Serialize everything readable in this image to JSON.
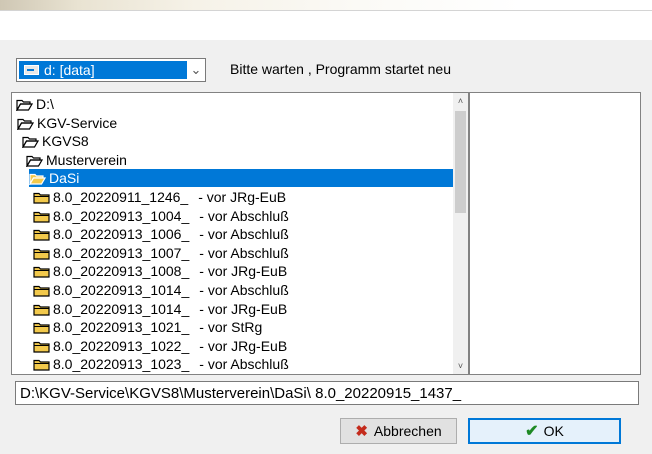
{
  "drive": {
    "label": "d: [data]",
    "arrow": "⌄"
  },
  "status": "Bitte warten , Programm startet neu",
  "tree": [
    {
      "name": "D:\\",
      "suffix": "",
      "icon": "open-folder",
      "depth": 0,
      "selected": false
    },
    {
      "name": "KGV-Service",
      "suffix": "",
      "icon": "open-folder",
      "depth": 1,
      "selected": false
    },
    {
      "name": "KGVS8",
      "suffix": "",
      "icon": "open-folder",
      "depth": 2,
      "selected": false
    },
    {
      "name": "Musterverein",
      "suffix": "",
      "icon": "open-folder",
      "depth": 3,
      "selected": false
    },
    {
      "name": "DaSi",
      "suffix": "",
      "icon": "open-folder",
      "depth": 4,
      "selected": true
    },
    {
      "name": "8.0_20220911_1246_",
      "suffix": "- vor JRg-EuB",
      "icon": "closed-folder",
      "depth": 5,
      "selected": false
    },
    {
      "name": "8.0_20220913_1004_",
      "suffix": "- vor Abschluß",
      "icon": "closed-folder",
      "depth": 5,
      "selected": false
    },
    {
      "name": "8.0_20220913_1006_",
      "suffix": "- vor Abschluß",
      "icon": "closed-folder",
      "depth": 5,
      "selected": false
    },
    {
      "name": "8.0_20220913_1007_",
      "suffix": "- vor Abschluß",
      "icon": "closed-folder",
      "depth": 5,
      "selected": false
    },
    {
      "name": "8.0_20220913_1008_",
      "suffix": "- vor JRg-EuB",
      "icon": "closed-folder",
      "depth": 5,
      "selected": false
    },
    {
      "name": "8.0_20220913_1014_",
      "suffix": "- vor Abschluß",
      "icon": "closed-folder",
      "depth": 5,
      "selected": false
    },
    {
      "name": "8.0_20220913_1014_",
      "suffix": "- vor JRg-EuB",
      "icon": "closed-folder",
      "depth": 5,
      "selected": false
    },
    {
      "name": "8.0_20220913_1021_",
      "suffix": "- vor StRg",
      "icon": "closed-folder",
      "depth": 5,
      "selected": false
    },
    {
      "name": "8.0_20220913_1022_",
      "suffix": "- vor JRg-EuB",
      "icon": "closed-folder",
      "depth": 5,
      "selected": false
    },
    {
      "name": "8.0_20220913_1023_",
      "suffix": "- vor Abschluß",
      "icon": "closed-folder",
      "depth": 5,
      "selected": false
    }
  ],
  "scroll": {
    "up": "˄",
    "down": "˅"
  },
  "path": "D:\\KGV-Service\\KGVS8\\Musterverein\\DaSi\\ 8.0_20220915_1437_",
  "buttons": {
    "cancel": "Abbrechen",
    "ok": "OK"
  },
  "colors": {
    "selection": "#0078d7",
    "folder": "#f2c94c",
    "cancel_icon": "#c42b1c",
    "ok_icon": "#1e8a25"
  }
}
